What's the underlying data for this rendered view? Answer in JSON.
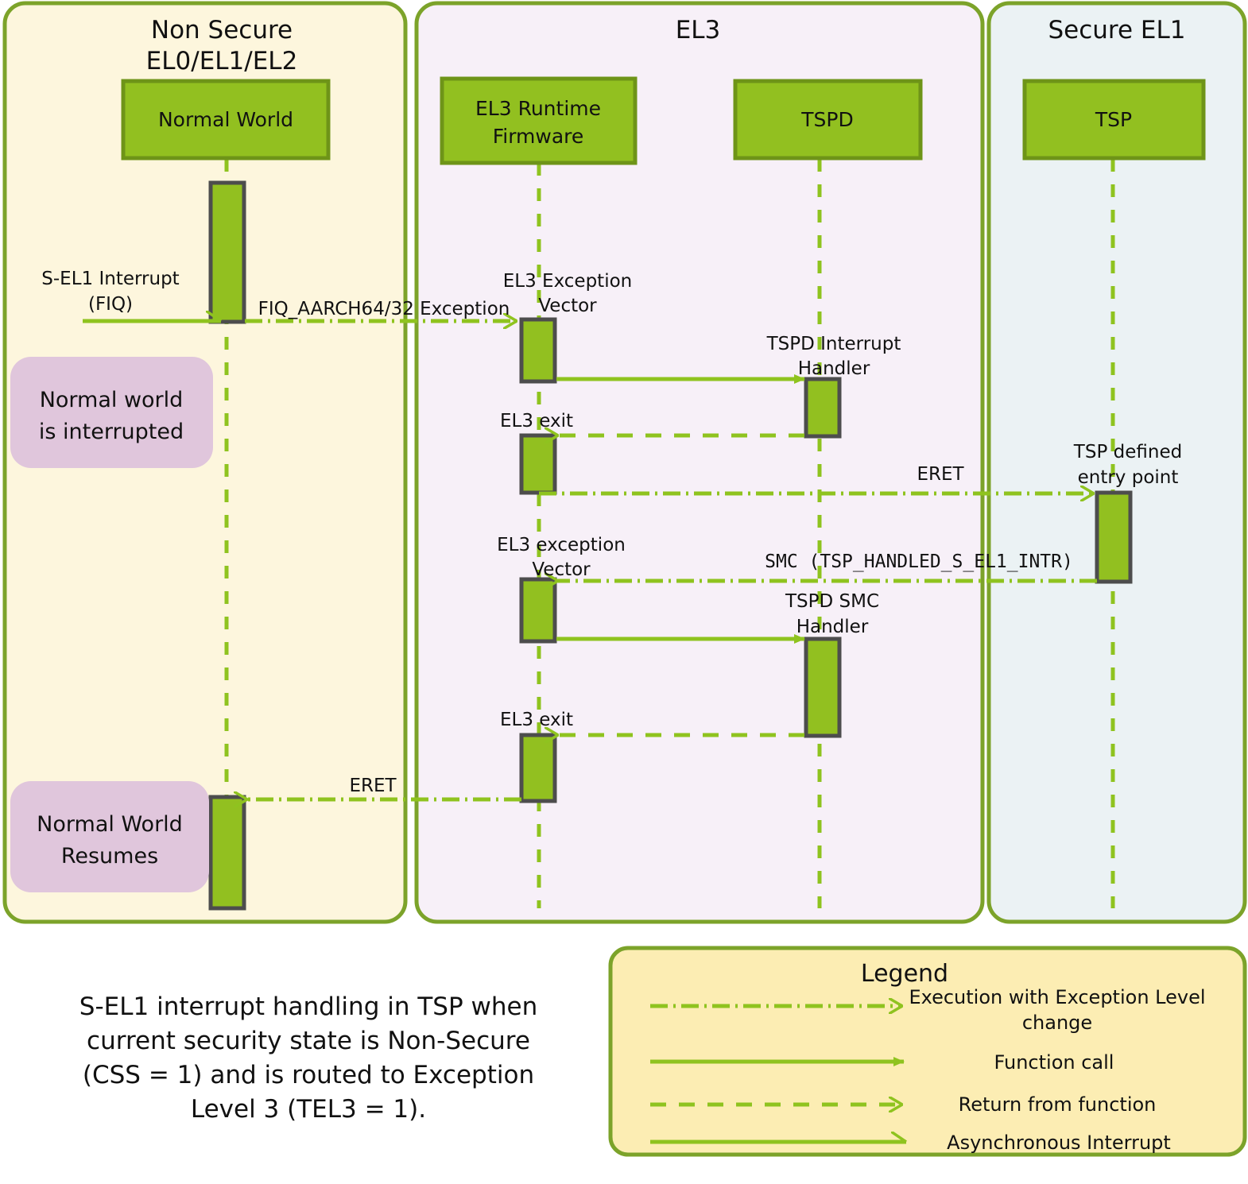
{
  "colors": {
    "green_fill": "#92C020",
    "green_stroke": "#6E9418",
    "box_stroke": "#4D4D4D",
    "panel_border": "#7CA32A",
    "nonsecure_bg": "#FDF6DD",
    "el3_bg": "#F7F0F8",
    "secure_bg": "#EBF2F4",
    "note_bg": "#E0C6DC",
    "legend_bg": "#FCEDB3",
    "arrow_green": "#8FC31F",
    "text": "#111111"
  },
  "panels": [
    {
      "id": "non-secure",
      "title_line1": "Non Secure",
      "title_line2": "EL0/EL1/EL2"
    },
    {
      "id": "el3",
      "title_line1": "EL3",
      "title_line2": ""
    },
    {
      "id": "secure-el1",
      "title_line1": "Secure EL1",
      "title_line2": ""
    }
  ],
  "actors": [
    {
      "id": "normal-world",
      "label_line1": "Normal World",
      "label_line2": ""
    },
    {
      "id": "el3-runtime-firmware",
      "label_line1": "EL3 Runtime",
      "label_line2": "Firmware"
    },
    {
      "id": "tspd",
      "label_line1": "TSPD",
      "label_line2": ""
    },
    {
      "id": "tsp",
      "label_line1": "TSP",
      "label_line2": ""
    }
  ],
  "messages": [
    {
      "id": "s-el1-interrupt",
      "line1": "S-EL1 Interrupt",
      "line2": "(FIQ)",
      "kind": "asynchronous-interrupt"
    },
    {
      "id": "fiq-exception",
      "line1": "FIQ_AARCH64/32 Exception",
      "line2": "",
      "kind": "execution-with-el-change"
    },
    {
      "id": "el3-exception-vector-1",
      "line1": "EL3 Exception",
      "line2": "Vector",
      "kind": "activation-label"
    },
    {
      "id": "tspd-interrupt-handler",
      "line1": "TSPD Interrupt",
      "line2": "Handler",
      "kind": "function-call"
    },
    {
      "id": "el3-exit-1",
      "line1": "EL3 exit",
      "line2": "",
      "kind": "return-from-function"
    },
    {
      "id": "eret-to-tsp",
      "line1": "ERET",
      "line2": "",
      "kind": "execution-with-el-change"
    },
    {
      "id": "tsp-defined-entry-point",
      "line1": "TSP defined",
      "line2": "entry point",
      "kind": "activation-label"
    },
    {
      "id": "smc-tsp-handled",
      "line1": "SMC (TSP_HANDLED_S_EL1_INTR)",
      "line2": "",
      "kind": "execution-with-el-change"
    },
    {
      "id": "el3-exception-vector-2",
      "line1": "EL3 exception",
      "line2": "Vector",
      "kind": "activation-label"
    },
    {
      "id": "tspd-smc-handler",
      "line1": "TSPD SMC",
      "line2": "Handler",
      "kind": "function-call"
    },
    {
      "id": "el3-exit-2",
      "line1": "EL3 exit",
      "line2": "",
      "kind": "return-from-function"
    },
    {
      "id": "eret-to-normal-world",
      "line1": "ERET",
      "line2": "",
      "kind": "execution-with-el-change"
    }
  ],
  "notes": [
    {
      "id": "normal-world-interrupted",
      "line1": "Normal world",
      "line2": "is interrupted"
    },
    {
      "id": "normal-world-resumes",
      "line1": "Normal World",
      "line2": "Resumes"
    }
  ],
  "caption": {
    "line1": "S-EL1 interrupt handling in TSP when",
    "line2": "current security state is Non-Secure",
    "line3": "(CSS = 1) and is routed to Exception",
    "line4": "Level 3 (TEL3 = 1)."
  },
  "legend": {
    "title": "Legend",
    "items": [
      {
        "id": "execution-with-el-change",
        "line1": "Execution with Exception Level",
        "line2": "change",
        "style": "dash-dot-open-arrow"
      },
      {
        "id": "function-call",
        "line1": "Function call",
        "line2": "",
        "style": "solid-filled-arrow"
      },
      {
        "id": "return-from-function",
        "line1": "Return from function",
        "line2": "",
        "style": "dashed-open-arrow"
      },
      {
        "id": "asynchronous-interrupt",
        "line1": "Asynchronous Interrupt",
        "line2": "",
        "style": "solid-half-open-arrow"
      }
    ]
  }
}
